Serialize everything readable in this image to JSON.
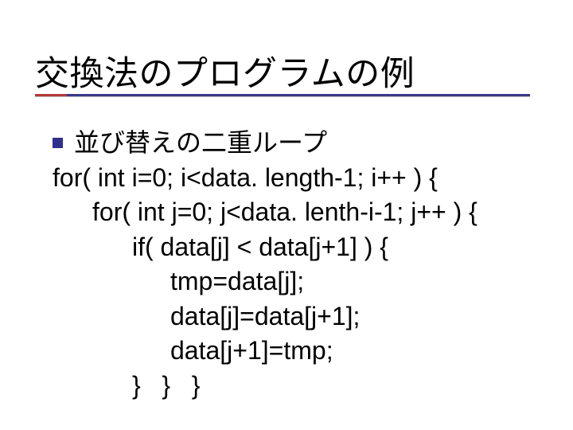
{
  "title": "交換法のプログラムの例",
  "bullet": "並び替えの二重ループ",
  "code": {
    "l1": "for( int i=0; i<data. length-1; i++ ) {",
    "l2": "for( int j=0; j<data. lenth-i-1; j++ ) {",
    "l3": "if( data[j] < data[j+1] ) {",
    "l4": "tmp=data[j];",
    "l5": "data[j]=data[j+1];",
    "l6": "data[j+1]=tmp;",
    "l7": "}   }   }"
  }
}
